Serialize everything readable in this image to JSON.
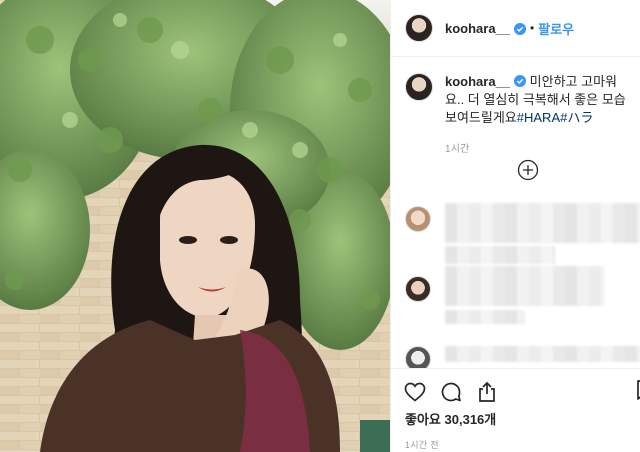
{
  "post": {
    "username": "koohara__",
    "follow_label": "팔로우",
    "dot": "•"
  },
  "caption": {
    "username": "koohara__",
    "text": " 미안하고 고마워요.. 더 열심히 극복해서 좋은 모습 보여드릴게요",
    "tags": [
      "#HARA",
      "#ハラ"
    ],
    "time": "1시간"
  },
  "feed": {
    "likes_prefix": "좋아요",
    "likes_count": "30,316개",
    "time": "1시간 전"
  },
  "colors": {
    "accent": "#3897f0",
    "tag": "#003569",
    "muted": "#999999"
  },
  "icons": {
    "verified": "verified-badge-icon",
    "load_more": "plus-circle-icon",
    "like": "heart-icon",
    "comment": "comment-icon",
    "share": "share-icon",
    "save": "bookmark-icon"
  }
}
